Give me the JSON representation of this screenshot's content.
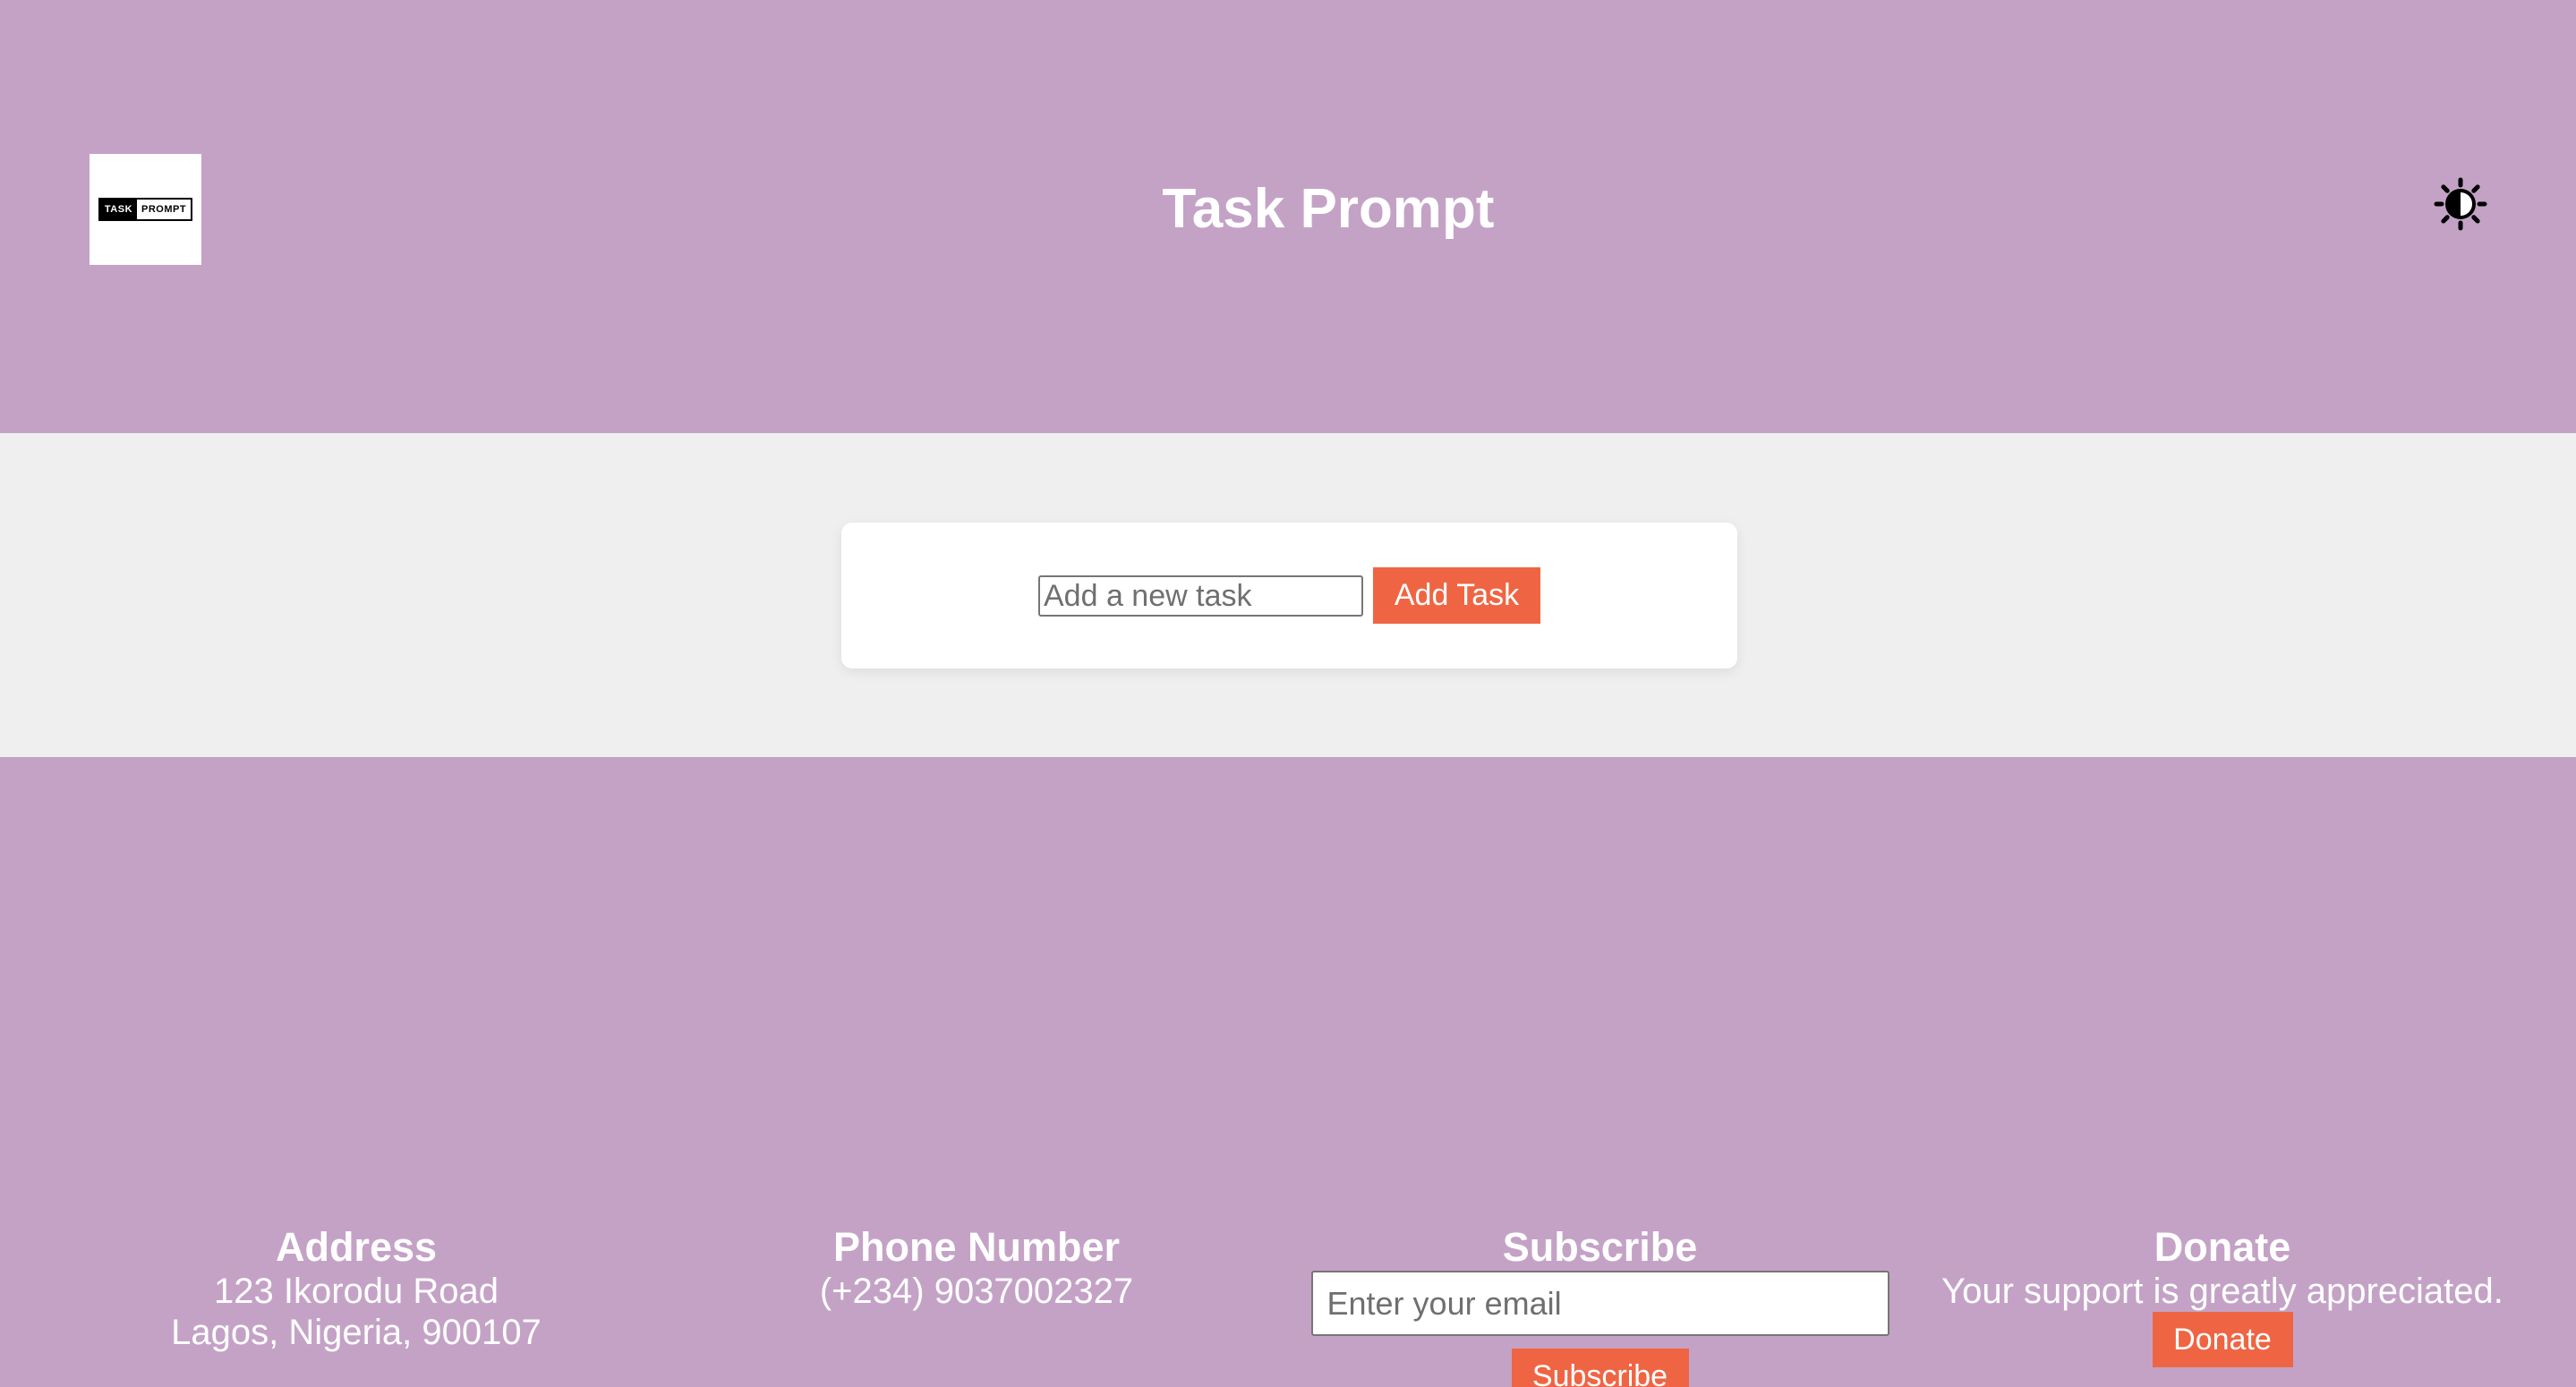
{
  "header": {
    "logo": {
      "text_left": "TASK",
      "text_right": "PROMPT"
    },
    "title": "Task Prompt",
    "theme_toggle_icon": "brightness-contrast-icon"
  },
  "task_form": {
    "input_placeholder": "Add a new task",
    "input_value": "",
    "add_button_label": "Add Task"
  },
  "footer": {
    "address": {
      "title": "Address",
      "line1": "123 Ikorodu Road",
      "line2": "Lagos, Nigeria, 900107"
    },
    "phone": {
      "title": "Phone Number",
      "number": "(+234) 9037002327"
    },
    "subscribe": {
      "title": "Subscribe",
      "email_placeholder": "Enter your email",
      "button_label": "Subscribe"
    },
    "donate": {
      "title": "Donate",
      "text": "Your support is greatly appreciated.",
      "button_label": "Donate"
    }
  },
  "colors": {
    "header_background": "#c4a2c6",
    "main_background": "#efefef",
    "accent": "#ef6543",
    "text_light": "#ffffff"
  }
}
